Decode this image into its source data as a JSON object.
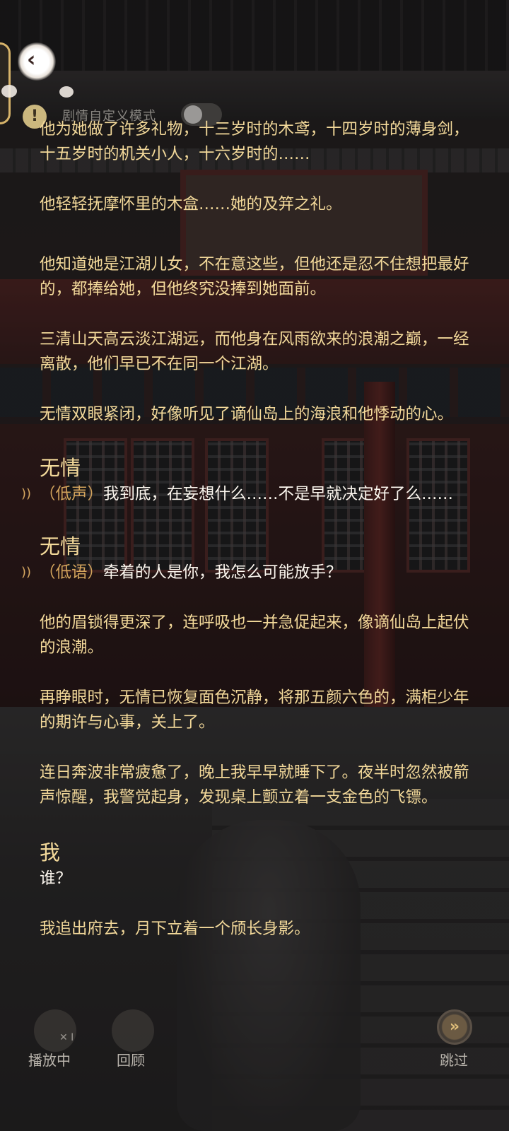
{
  "header": {
    "back_icon": "chevron-left-icon",
    "alert_icon": "exclamation-icon",
    "alert_glyph": "!",
    "mode_label": "剧情自定义模式",
    "mode_toggle_on": false
  },
  "story": {
    "paragraphs": [
      "他为她做了许多礼物，十三岁时的木鸢，十四岁时的薄身剑，十五岁时的机关小人，十六岁时的……",
      "他轻轻抚摩怀里的木盒……她的及笄之礼。",
      "他知道她是江湖儿女，不在意这些，但他还是忍不住想把最好的，都捧给她，但他终究没捧到她面前。",
      "三清山天高云淡江湖远，而他身在风雨欲来的浪潮之巅，一经离散，他们早已不在同一个江湖。",
      "无情双眼紧闭，好像听见了谪仙岛上的海浪和他悸动的心。"
    ],
    "dialogue1": {
      "speaker": "无情",
      "tone": "（低声）",
      "line": "我到底，在妄想什么……不是早就决定好了么……"
    },
    "dialogue2": {
      "speaker": "无情",
      "tone": "（低语）",
      "line": "牵着的人是你，我怎么可能放手？"
    },
    "paragraphs2": [
      "他的眉锁得更深了，连呼吸也一并急促起来，像谪仙岛上起伏的浪潮。",
      "再睁眼时，无情已恢复面色沉静，将那五颜六色的，满柜少年的期许与心事，关上了。",
      "连日奔波非常疲惫了，晚上我早早就睡下了。夜半时忽然被箭声惊醒，我警觉起身，发现桌上颤立着一支金色的飞镖。"
    ],
    "dialogue3": {
      "speaker": "我",
      "line": "谁？"
    },
    "last_paragraph": "我追出府去，月下立着一个颀长身影。"
  },
  "controls": {
    "auto_play_label": "播放中",
    "review_label": "回顾",
    "skip_label": "跳过",
    "skip_glyph": "»"
  },
  "colors": {
    "narration": "#f3d99a",
    "dialogue": "#fbf6ee",
    "tone": "#d3a45c"
  }
}
